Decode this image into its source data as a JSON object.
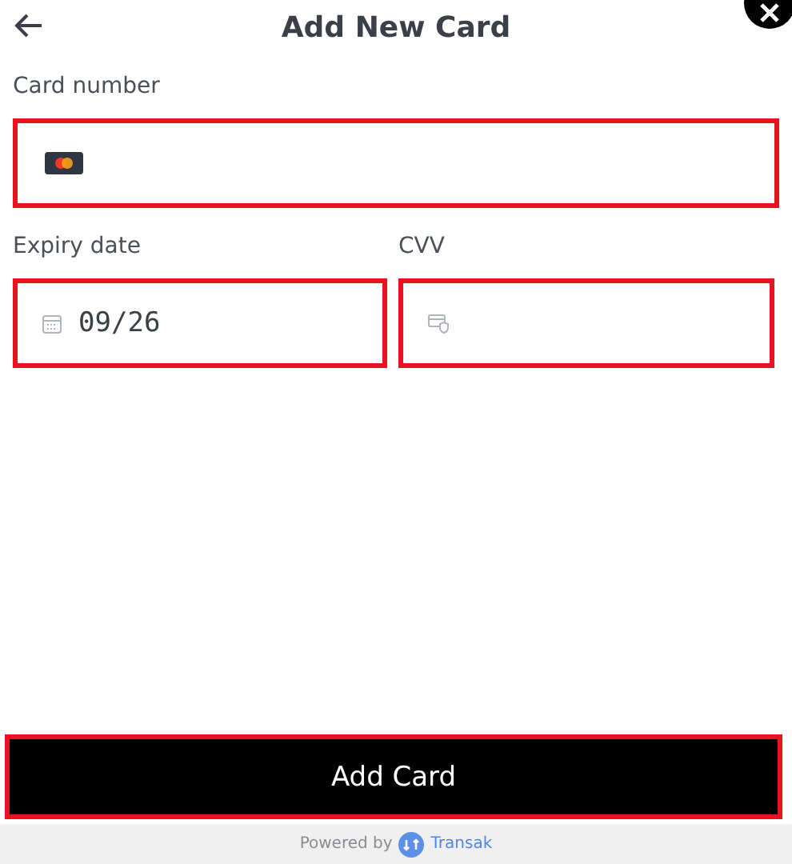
{
  "header": {
    "title": "Add New Card"
  },
  "fields": [
    {
      "kind": "card",
      "label": "Card number"
    },
    {
      "kind": "expiry",
      "label": "Expiry date",
      "value": "09/26"
    },
    {
      "kind": "cvv",
      "label": "CVV"
    }
  ],
  "submit_button": {
    "label": "Add Card"
  },
  "footer": {
    "prefix": "Powered by",
    "brand": "Transak"
  }
}
